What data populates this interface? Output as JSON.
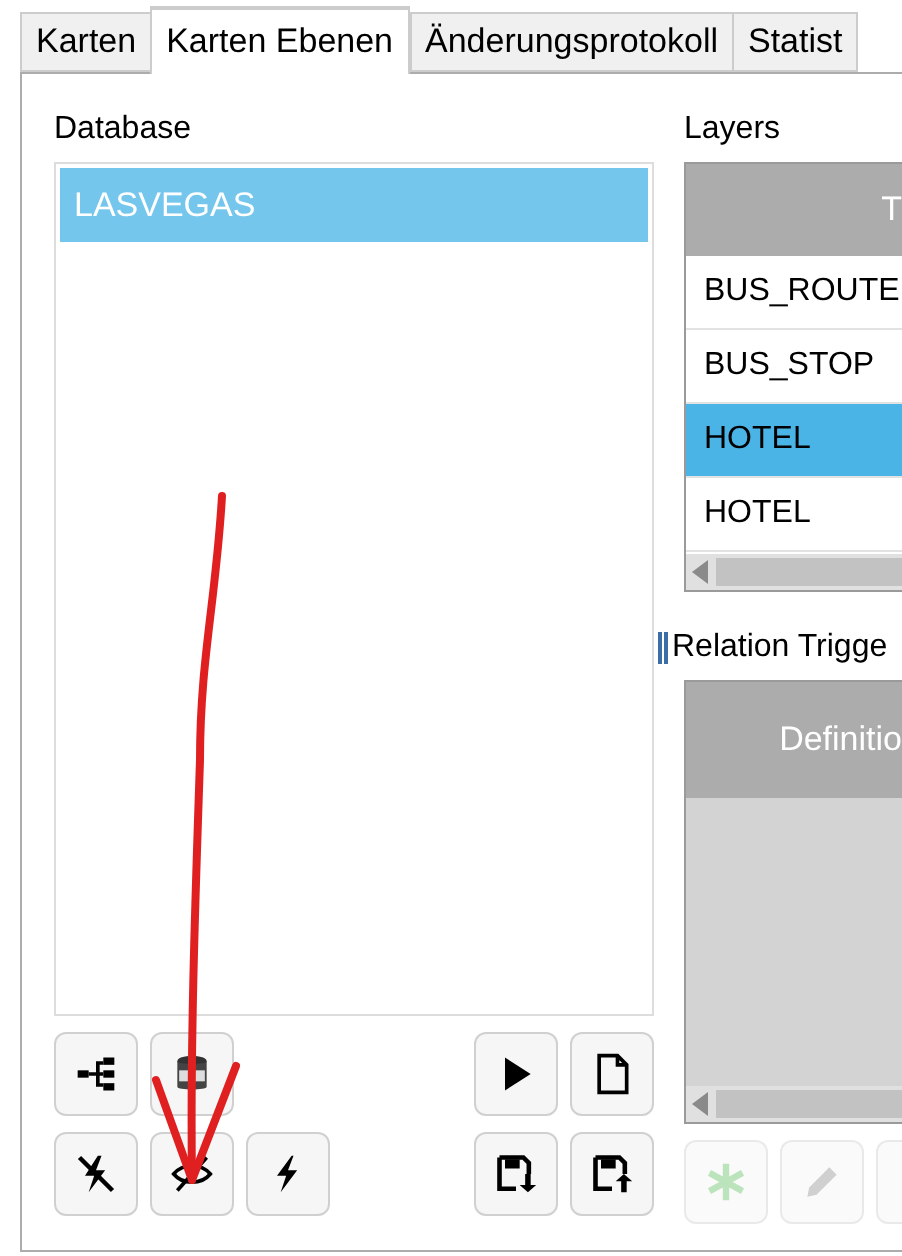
{
  "tabs": [
    {
      "label": "Karten",
      "selected": false
    },
    {
      "label": "Karten Ebenen",
      "selected": true
    },
    {
      "label": "Änderungsprotokoll",
      "selected": false
    },
    {
      "label": "Statist",
      "selected": false
    }
  ],
  "database": {
    "label": "Database",
    "items": [
      {
        "label": "LASVEGAS",
        "selected": true
      }
    ],
    "buttons": [
      [
        {
          "kind": "tree",
          "disabled": false
        },
        {
          "kind": "sql",
          "disabled": false
        },
        {
          "kind": "gap"
        },
        {
          "kind": "play",
          "disabled": false
        },
        {
          "kind": "document",
          "disabled": false
        }
      ],
      [
        {
          "kind": "no-flash",
          "disabled": false
        },
        {
          "kind": "eye-slash",
          "disabled": false
        },
        {
          "kind": "flash",
          "disabled": false
        },
        {
          "kind": "gap"
        },
        {
          "kind": "save-down",
          "disabled": false
        },
        {
          "kind": "save-up",
          "disabled": false
        }
      ]
    ]
  },
  "layers": {
    "label": "Layers",
    "columns": [
      "T"
    ],
    "rows": [
      {
        "label": "BUS_ROUTE",
        "selected": false
      },
      {
        "label": "BUS_STOP",
        "selected": false
      },
      {
        "label": "HOTEL",
        "selected": true
      },
      {
        "label": "HOTEL",
        "selected": false
      }
    ]
  },
  "relation_triggers": {
    "label": "Relation Trigge",
    "columns": [
      "Definitio"
    ],
    "buttons": [
      {
        "kind": "add",
        "disabled": true
      },
      {
        "kind": "edit",
        "disabled": true
      },
      {
        "kind": "blank",
        "disabled": true
      }
    ]
  }
}
